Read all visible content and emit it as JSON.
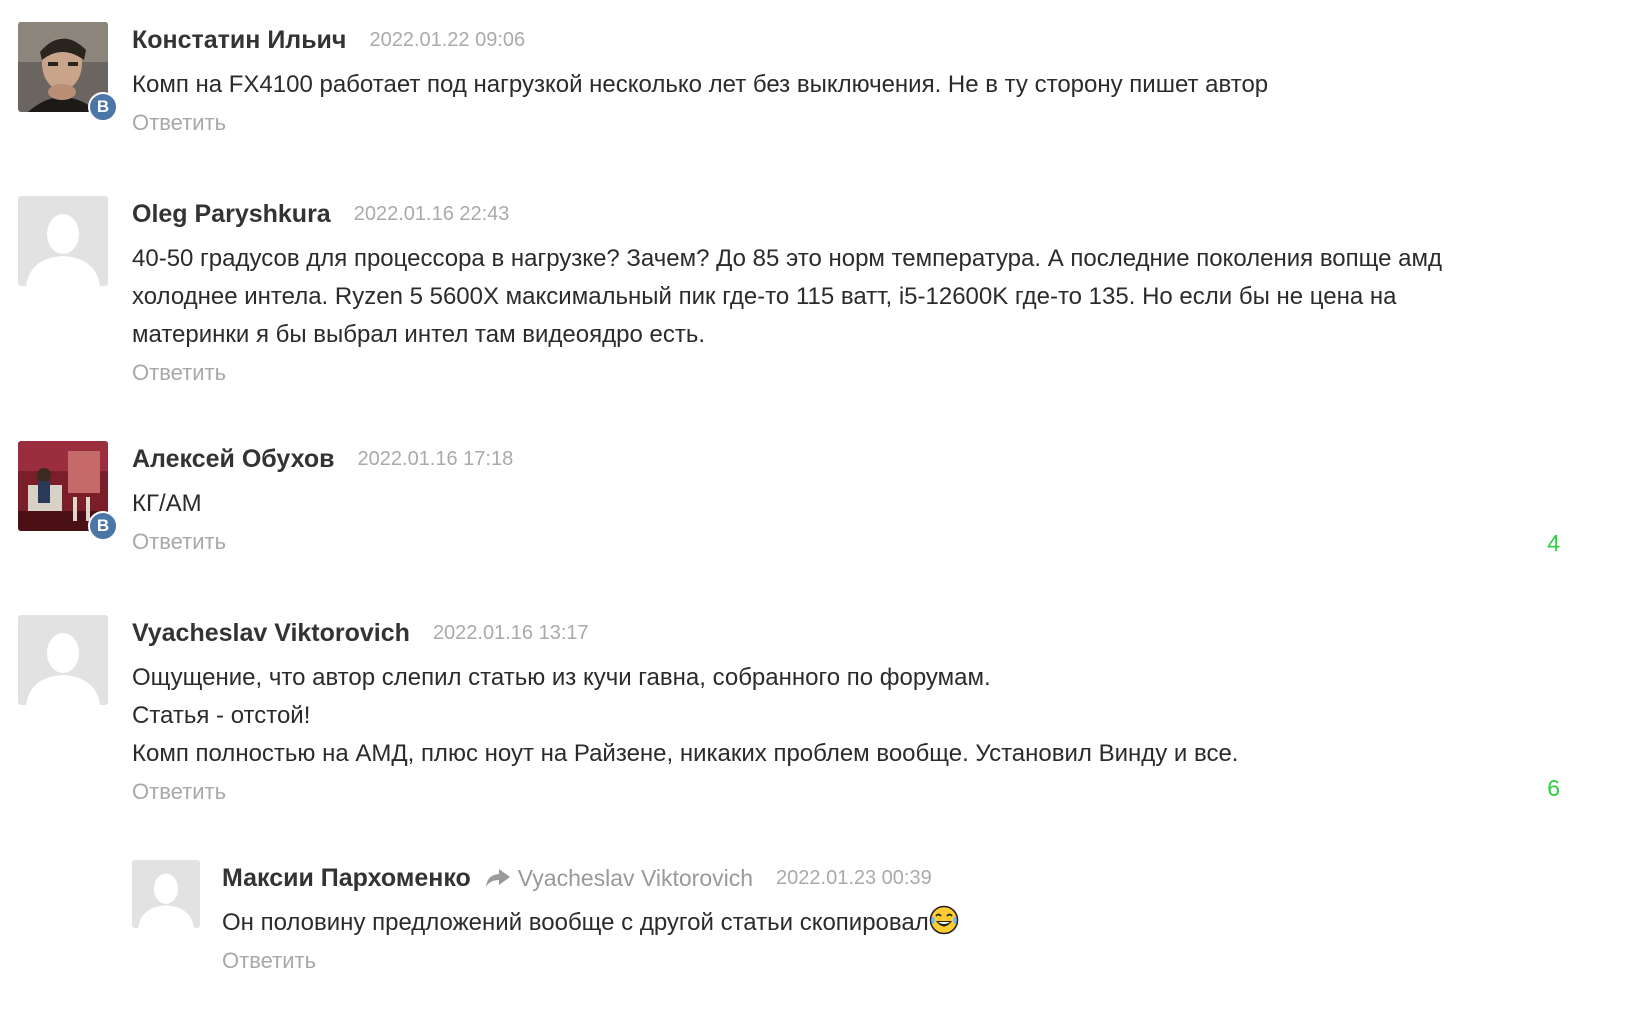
{
  "comments": [
    {
      "author": "Констатин Ильич",
      "date": "2022.01.22 09:06",
      "text": [
        "Комп на FX4100 работает под нагрузкой несколько лет без выключения. Не в ту сторону пишет автор"
      ],
      "reply_label": "Ответить",
      "avatar": "photo-man-icon",
      "badge": "В"
    },
    {
      "author": "Oleg Paryshkura",
      "date": "2022.01.16 22:43",
      "text": [
        "40-50 градусов для процессора в нагрузке? Зачем? До 85 это норм температура. А последние поколения вопще амд",
        "холоднее интела. Ryzen 5 5600X максимальный пик где-то 115 ватт, i5-12600K где-то 135. Но если бы не цена на",
        "материнки я бы выбрал интел там видеоядро есть."
      ],
      "reply_label": "Ответить",
      "avatar": "default-user-icon"
    },
    {
      "author": "Алексей Обухов",
      "date": "2022.01.16 17:18",
      "text": [
        "КГ/АМ"
      ],
      "reply_label": "Ответить",
      "avatar": "photo-room-icon",
      "badge": "В",
      "score": "4"
    },
    {
      "author": "Vyacheslav Viktorovich",
      "date": "2022.01.16 13:17",
      "text": [
        "Ощущение, что автор слепил статью из кучи гавна, собранного по форумам.",
        "Статья - отстой!",
        "Комп полностью на АМД, плюс ноут на Райзене, никаких проблем вообще. Установил Винду и все."
      ],
      "reply_label": "Ответить",
      "avatar": "default-user-icon",
      "score": "6"
    }
  ],
  "reply": {
    "author": "Максии Пархоменко",
    "reply_to": "Vyacheslav Viktorovich",
    "date": "2022.01.23 00:39",
    "text": "Он половину предложений вообще с другой статьи скопировал",
    "emoji": "laughing-tears-emoji",
    "reply_label": "Ответить",
    "avatar": "default-user-icon"
  },
  "colors": {
    "score": "#2fcf3f",
    "vk_badge": "#4a76a8",
    "muted": "#aaaaaa"
  }
}
